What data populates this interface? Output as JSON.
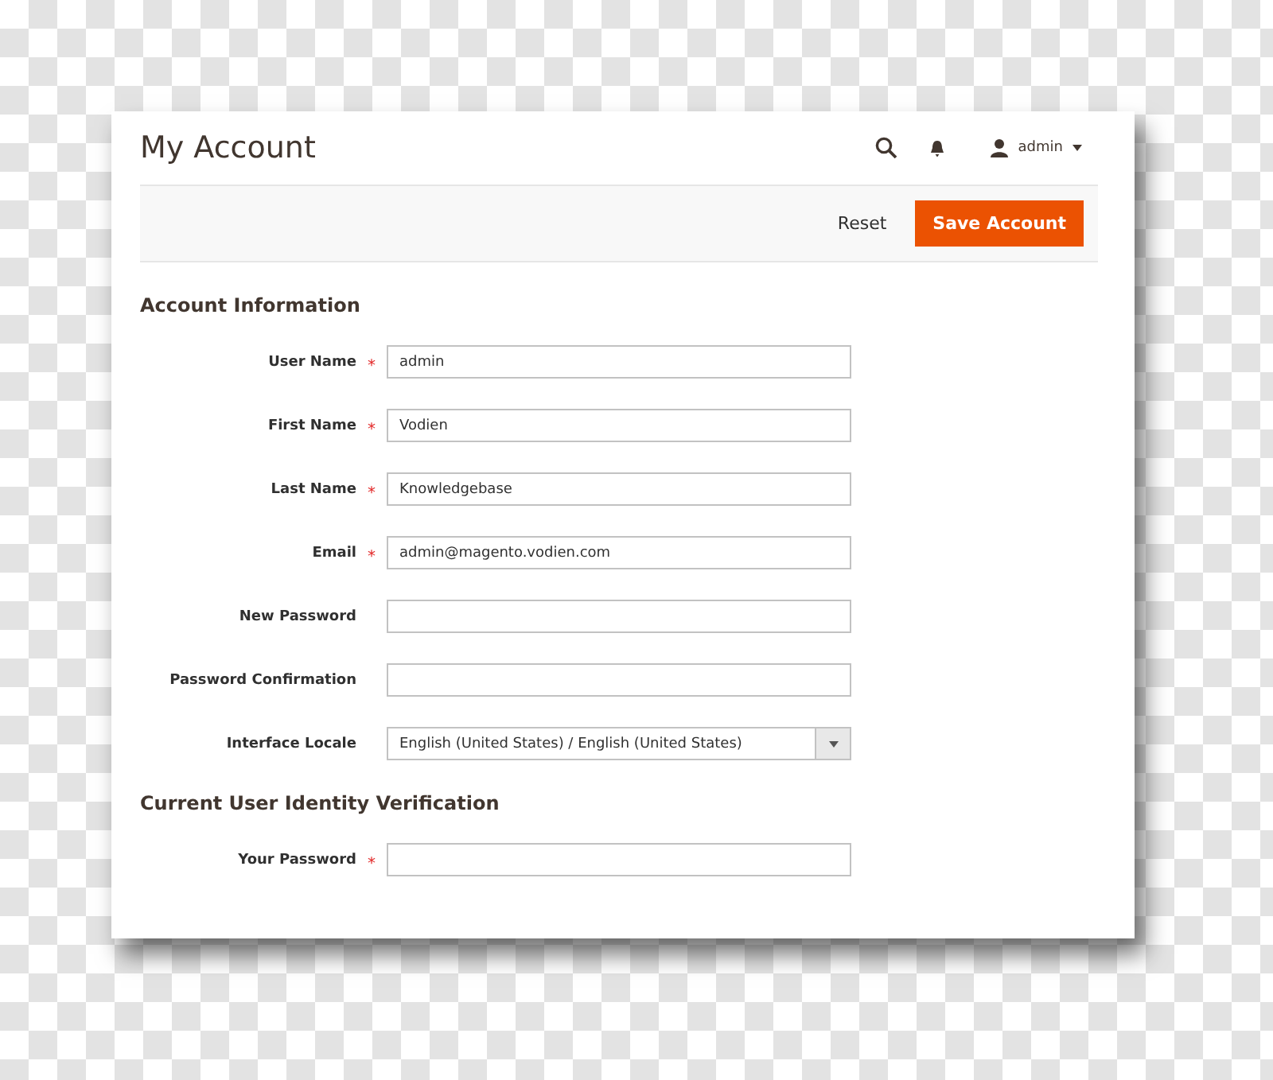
{
  "header": {
    "title": "My Account",
    "user": "admin"
  },
  "actions": {
    "reset": "Reset",
    "save": "Save Account"
  },
  "required_mark": "*",
  "sections": [
    {
      "title": "Account Information",
      "fields": [
        {
          "label": "User Name",
          "required": true,
          "kind": "text",
          "value": "admin"
        },
        {
          "label": "First Name",
          "required": true,
          "kind": "text",
          "value": "Vodien"
        },
        {
          "label": "Last Name",
          "required": true,
          "kind": "text",
          "value": "Knowledgebase"
        },
        {
          "label": "Email",
          "required": true,
          "kind": "text",
          "value": "admin@magento.vodien.com"
        },
        {
          "label": "New Password",
          "required": false,
          "kind": "text"
        },
        {
          "label": "Password Confirmation",
          "required": false,
          "kind": "text"
        },
        {
          "label": "Interface Locale",
          "required": false,
          "kind": "select",
          "value": "English (United States) / English (United States)"
        }
      ]
    },
    {
      "title": "Current User Identity Verification",
      "fields": [
        {
          "label": "Your Password",
          "required": true,
          "kind": "text"
        }
      ]
    }
  ]
}
